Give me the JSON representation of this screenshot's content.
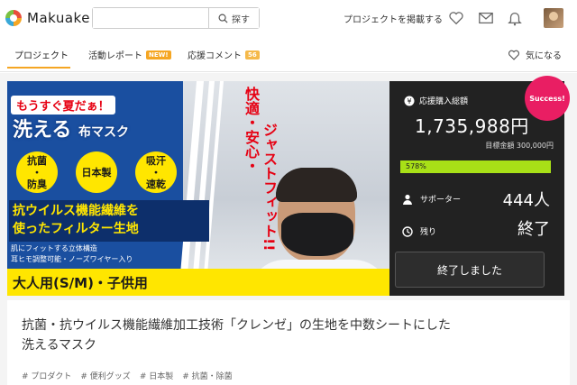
{
  "header": {
    "logo": "Makuake",
    "search": {
      "placeholder": "",
      "button_label": "探す"
    },
    "post_project": "プロジェクトを掲載する"
  },
  "tabs": [
    {
      "label": "プロジェクト"
    },
    {
      "label": "活動レポート",
      "badge": "NEW!"
    },
    {
      "label": "応援コメント",
      "badge": "56"
    }
  ],
  "favorite_label": "気になる",
  "hero": {
    "soon_summer": "もうすぐ夏だぁ！",
    "washable": "洗える",
    "cloth_mask": "布マスク",
    "circles": [
      "抗菌\n・\n防臭",
      "日本製",
      "吸汗\n・\n速乾"
    ],
    "vertical_1": "快適・安心・",
    "vertical_2": "ジャストフィット!!",
    "antivirus_line1": "抗ウイルス機能繊維を",
    "antivirus_line2": "使ったフィルター生地",
    "feature_1": "肌にフィットする立体構造",
    "feature_2": "耳ヒモ調整可能・ノーズワイヤー入り",
    "sizes": "大人用(S/M)・子供用"
  },
  "panel": {
    "success_badge": "Success!",
    "total_label": "応援購入総額",
    "total_amount": "1,735,988円",
    "goal": "目標金額 300,000円",
    "progress_percent": 578,
    "progress_text": "578%",
    "supporters_label": "サポーター",
    "supporters_value": "444人",
    "remaining_label": "残り",
    "remaining_value": "終了",
    "ended_button": "終了しました"
  },
  "project": {
    "title_line1": "抗菌・抗ウイルス機能繊維加工技術「クレンゼ」の生地を中数シートにした",
    "title_line2": "洗えるマスク",
    "tags": [
      "# プロダクト",
      "# 便利グッズ",
      "# 日本製",
      "# 抗菌・除菌"
    ]
  },
  "colors": {
    "accent": "#f5a623",
    "hero_blue": "#1a4fa0",
    "highlight_yellow": "#ffe600",
    "progress_green": "#a8e017",
    "success_pink": "#e91e63",
    "panel_dark": "#222222"
  }
}
